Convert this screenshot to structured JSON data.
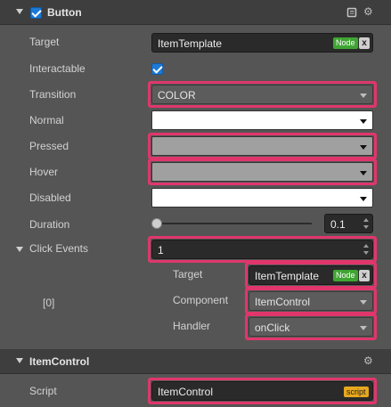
{
  "button_section": {
    "title": "Button",
    "enabled": true,
    "icons": [
      "book-icon",
      "gear-icon"
    ]
  },
  "fields": {
    "target": {
      "label": "Target",
      "value": "ItemTemplate",
      "tag": "Node",
      "clear": "x"
    },
    "interactable": {
      "label": "Interactable",
      "checked": true
    },
    "transition": {
      "label": "Transition",
      "value": "COLOR"
    },
    "normal": {
      "label": "Normal",
      "color": "#ffffff"
    },
    "pressed": {
      "label": "Pressed",
      "color": "#a0a0a0"
    },
    "hover": {
      "label": "Hover",
      "color": "#a0a0a0"
    },
    "disabled": {
      "label": "Disabled",
      "color": "#ffffff"
    },
    "duration": {
      "label": "Duration",
      "value": "0.1"
    }
  },
  "click_events": {
    "label": "Click Events",
    "count": "1",
    "item_index": "[0]",
    "target": {
      "label": "Target",
      "value": "ItemTemplate",
      "tag": "Node",
      "clear": "x"
    },
    "component": {
      "label": "Component",
      "value": "ItemControl"
    },
    "handler": {
      "label": "Handler",
      "value": "onClick"
    }
  },
  "itemcontrol_section": {
    "title": "ItemControl",
    "icons": [
      "gear-icon"
    ],
    "script": {
      "label": "Script",
      "value": "ItemControl",
      "tag": "script"
    }
  },
  "colors": {
    "panel_bg": "#555555",
    "header_bg": "#3e3e3e",
    "highlight": "#e0366c",
    "node_tag": "#3fa532",
    "script_tag": "#e7a81e",
    "checkbox": "#1c7ad6"
  }
}
